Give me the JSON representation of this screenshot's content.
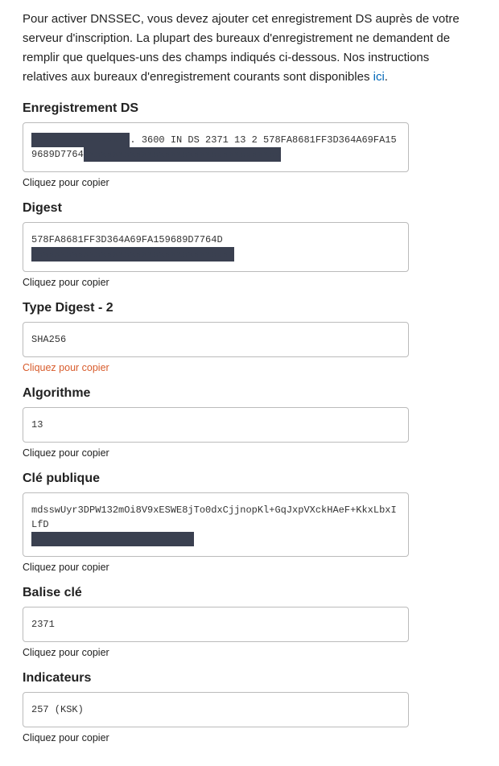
{
  "intro": {
    "text_before_link": "Pour activer DNSSEC, vous devez ajouter cet enregistrement DS auprès de votre serveur d'inscription. La plupart des bureaux d'enregistrement ne demandent de remplir que quelques-uns des champs indiqués ci-dessous. Nos instructions relatives aux bureaux d'enregistrement courants sont disponibles ",
    "link_text": "ici",
    "text_after_link": "."
  },
  "copy_hint": "Cliquez pour copier",
  "fields": {
    "ds_record": {
      "label": "Enregistrement DS",
      "redacted1": "xxxxxxxxxxxxxxxxx",
      "middle": ". 3600 IN DS 2371 13 2 578FA8681FF3D364A69FA159689D7764",
      "redacted2": "Dxxxxxxxxxxxxxxxxxxxxxxxxxxxxxxxxx"
    },
    "digest": {
      "label": "Digest",
      "visible": "578FA8681FF3D364A69FA159689D7764D",
      "redacted": "xxxxxxxxxxxxxxxxxxxxxxxxxxxxxxxxxxx"
    },
    "digest_type": {
      "label": "Type Digest - 2",
      "value": "SHA256"
    },
    "algorithm": {
      "label": "Algorithme",
      "value": "13"
    },
    "public_key": {
      "label": "Clé publique",
      "line1": "mdsswUyr3DPW132mOi8V9xESWE8jTo0dxCjjnopKl+GqJxpVXckHAeF+KkxLbxILfD",
      "redacted": "xxxxxxxxxxxxxxxxxxxxxxxxxxxx"
    },
    "key_tag": {
      "label": "Balise clé",
      "value": "2371"
    },
    "flags": {
      "label": "Indicateurs",
      "value": "257 (KSK)"
    }
  }
}
